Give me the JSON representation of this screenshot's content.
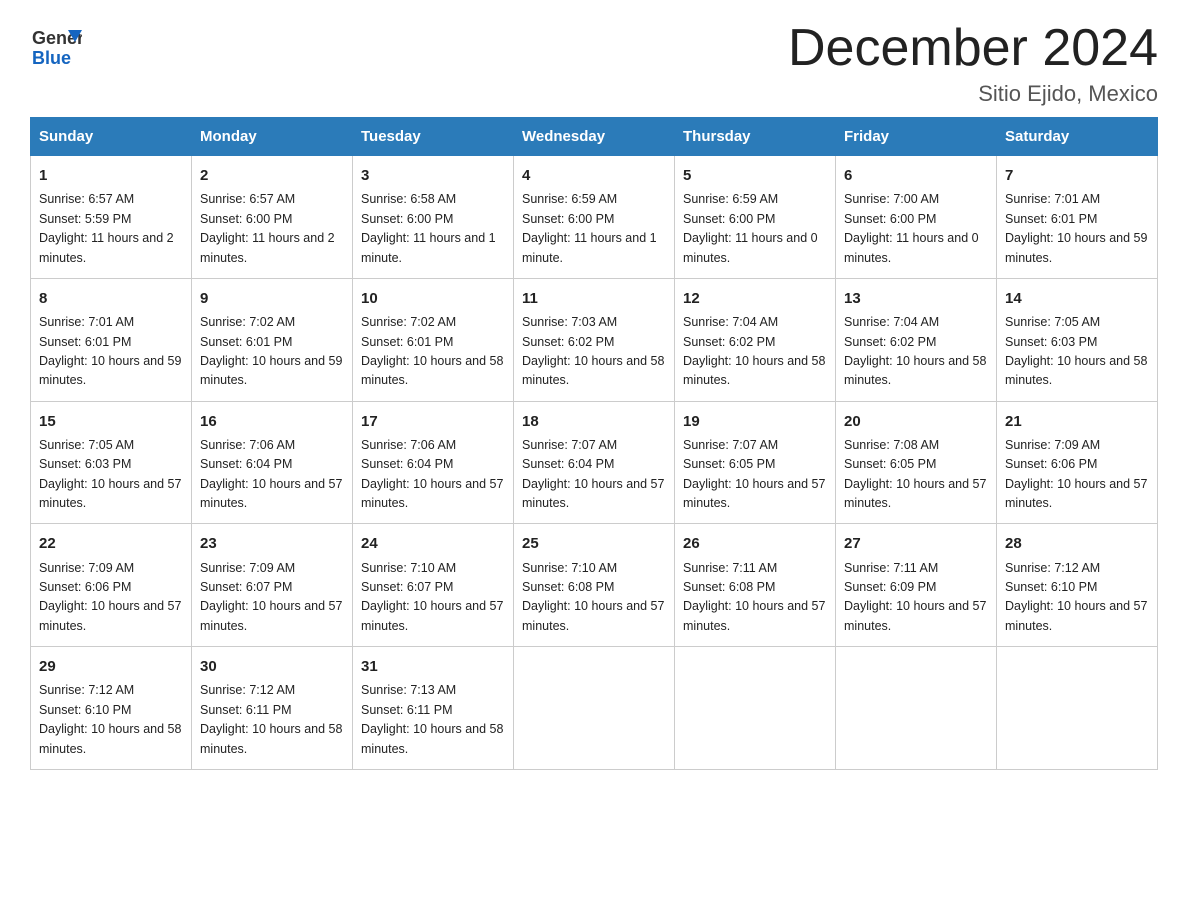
{
  "logo": {
    "general": "General",
    "blue": "Blue"
  },
  "title": "December 2024",
  "location": "Sitio Ejido, Mexico",
  "weekdays": [
    "Sunday",
    "Monday",
    "Tuesday",
    "Wednesday",
    "Thursday",
    "Friday",
    "Saturday"
  ],
  "weeks": [
    [
      {
        "day": "1",
        "sunrise": "Sunrise: 6:57 AM",
        "sunset": "Sunset: 5:59 PM",
        "daylight": "Daylight: 11 hours and 2 minutes."
      },
      {
        "day": "2",
        "sunrise": "Sunrise: 6:57 AM",
        "sunset": "Sunset: 6:00 PM",
        "daylight": "Daylight: 11 hours and 2 minutes."
      },
      {
        "day": "3",
        "sunrise": "Sunrise: 6:58 AM",
        "sunset": "Sunset: 6:00 PM",
        "daylight": "Daylight: 11 hours and 1 minute."
      },
      {
        "day": "4",
        "sunrise": "Sunrise: 6:59 AM",
        "sunset": "Sunset: 6:00 PM",
        "daylight": "Daylight: 11 hours and 1 minute."
      },
      {
        "day": "5",
        "sunrise": "Sunrise: 6:59 AM",
        "sunset": "Sunset: 6:00 PM",
        "daylight": "Daylight: 11 hours and 0 minutes."
      },
      {
        "day": "6",
        "sunrise": "Sunrise: 7:00 AM",
        "sunset": "Sunset: 6:00 PM",
        "daylight": "Daylight: 11 hours and 0 minutes."
      },
      {
        "day": "7",
        "sunrise": "Sunrise: 7:01 AM",
        "sunset": "Sunset: 6:01 PM",
        "daylight": "Daylight: 10 hours and 59 minutes."
      }
    ],
    [
      {
        "day": "8",
        "sunrise": "Sunrise: 7:01 AM",
        "sunset": "Sunset: 6:01 PM",
        "daylight": "Daylight: 10 hours and 59 minutes."
      },
      {
        "day": "9",
        "sunrise": "Sunrise: 7:02 AM",
        "sunset": "Sunset: 6:01 PM",
        "daylight": "Daylight: 10 hours and 59 minutes."
      },
      {
        "day": "10",
        "sunrise": "Sunrise: 7:02 AM",
        "sunset": "Sunset: 6:01 PM",
        "daylight": "Daylight: 10 hours and 58 minutes."
      },
      {
        "day": "11",
        "sunrise": "Sunrise: 7:03 AM",
        "sunset": "Sunset: 6:02 PM",
        "daylight": "Daylight: 10 hours and 58 minutes."
      },
      {
        "day": "12",
        "sunrise": "Sunrise: 7:04 AM",
        "sunset": "Sunset: 6:02 PM",
        "daylight": "Daylight: 10 hours and 58 minutes."
      },
      {
        "day": "13",
        "sunrise": "Sunrise: 7:04 AM",
        "sunset": "Sunset: 6:02 PM",
        "daylight": "Daylight: 10 hours and 58 minutes."
      },
      {
        "day": "14",
        "sunrise": "Sunrise: 7:05 AM",
        "sunset": "Sunset: 6:03 PM",
        "daylight": "Daylight: 10 hours and 58 minutes."
      }
    ],
    [
      {
        "day": "15",
        "sunrise": "Sunrise: 7:05 AM",
        "sunset": "Sunset: 6:03 PM",
        "daylight": "Daylight: 10 hours and 57 minutes."
      },
      {
        "day": "16",
        "sunrise": "Sunrise: 7:06 AM",
        "sunset": "Sunset: 6:04 PM",
        "daylight": "Daylight: 10 hours and 57 minutes."
      },
      {
        "day": "17",
        "sunrise": "Sunrise: 7:06 AM",
        "sunset": "Sunset: 6:04 PM",
        "daylight": "Daylight: 10 hours and 57 minutes."
      },
      {
        "day": "18",
        "sunrise": "Sunrise: 7:07 AM",
        "sunset": "Sunset: 6:04 PM",
        "daylight": "Daylight: 10 hours and 57 minutes."
      },
      {
        "day": "19",
        "sunrise": "Sunrise: 7:07 AM",
        "sunset": "Sunset: 6:05 PM",
        "daylight": "Daylight: 10 hours and 57 minutes."
      },
      {
        "day": "20",
        "sunrise": "Sunrise: 7:08 AM",
        "sunset": "Sunset: 6:05 PM",
        "daylight": "Daylight: 10 hours and 57 minutes."
      },
      {
        "day": "21",
        "sunrise": "Sunrise: 7:09 AM",
        "sunset": "Sunset: 6:06 PM",
        "daylight": "Daylight: 10 hours and 57 minutes."
      }
    ],
    [
      {
        "day": "22",
        "sunrise": "Sunrise: 7:09 AM",
        "sunset": "Sunset: 6:06 PM",
        "daylight": "Daylight: 10 hours and 57 minutes."
      },
      {
        "day": "23",
        "sunrise": "Sunrise: 7:09 AM",
        "sunset": "Sunset: 6:07 PM",
        "daylight": "Daylight: 10 hours and 57 minutes."
      },
      {
        "day": "24",
        "sunrise": "Sunrise: 7:10 AM",
        "sunset": "Sunset: 6:07 PM",
        "daylight": "Daylight: 10 hours and 57 minutes."
      },
      {
        "day": "25",
        "sunrise": "Sunrise: 7:10 AM",
        "sunset": "Sunset: 6:08 PM",
        "daylight": "Daylight: 10 hours and 57 minutes."
      },
      {
        "day": "26",
        "sunrise": "Sunrise: 7:11 AM",
        "sunset": "Sunset: 6:08 PM",
        "daylight": "Daylight: 10 hours and 57 minutes."
      },
      {
        "day": "27",
        "sunrise": "Sunrise: 7:11 AM",
        "sunset": "Sunset: 6:09 PM",
        "daylight": "Daylight: 10 hours and 57 minutes."
      },
      {
        "day": "28",
        "sunrise": "Sunrise: 7:12 AM",
        "sunset": "Sunset: 6:10 PM",
        "daylight": "Daylight: 10 hours and 57 minutes."
      }
    ],
    [
      {
        "day": "29",
        "sunrise": "Sunrise: 7:12 AM",
        "sunset": "Sunset: 6:10 PM",
        "daylight": "Daylight: 10 hours and 58 minutes."
      },
      {
        "day": "30",
        "sunrise": "Sunrise: 7:12 AM",
        "sunset": "Sunset: 6:11 PM",
        "daylight": "Daylight: 10 hours and 58 minutes."
      },
      {
        "day": "31",
        "sunrise": "Sunrise: 7:13 AM",
        "sunset": "Sunset: 6:11 PM",
        "daylight": "Daylight: 10 hours and 58 minutes."
      },
      null,
      null,
      null,
      null
    ]
  ]
}
